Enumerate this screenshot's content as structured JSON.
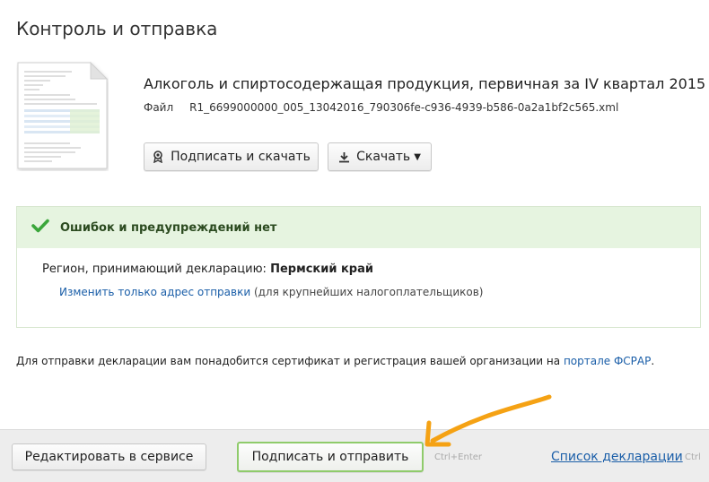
{
  "page": {
    "title": "Контроль и отправка"
  },
  "file": {
    "title": "Алкоголь и спиртосодержащая продукция, первичная за IV квартал 2015",
    "label": "Файл",
    "name": "R1_6699000000_005_13042016_790306fe-c936-4939-b586-0a2a1bf2c565.xml"
  },
  "actions": {
    "sign_download": "Подписать и скачать",
    "download": "Скачать"
  },
  "check": {
    "message": "Ошибок и предупреждений нет",
    "region_label": "Регион, принимающий декларацию:",
    "region_value": "Пермский край",
    "change_link": "Изменить только адрес отправки",
    "change_note": "(для крупнейших налогоплательщиков)"
  },
  "info": {
    "text": "Для отправки декларации вам понадобится сертификат и регистрация вашей организации на",
    "link": "портале ФСРАР",
    "end": "."
  },
  "footer": {
    "edit": "Редактировать в сервисе",
    "send": "Подписать и отправить",
    "send_hint": "Ctrl+Enter",
    "list": "Список декларации",
    "list_hint": "Ctrl"
  },
  "colors": {
    "success_bg": "#e6f4e0",
    "success_check": "#3aa63a",
    "link": "#1a5ea8",
    "arrow": "#f5a214",
    "send_border": "#8fcb6b"
  },
  "icons": {
    "document_preview": "document-thumbnail",
    "sign": "seal-icon",
    "download": "download-icon",
    "success": "check-icon",
    "annotation": "arrow-annotation"
  }
}
